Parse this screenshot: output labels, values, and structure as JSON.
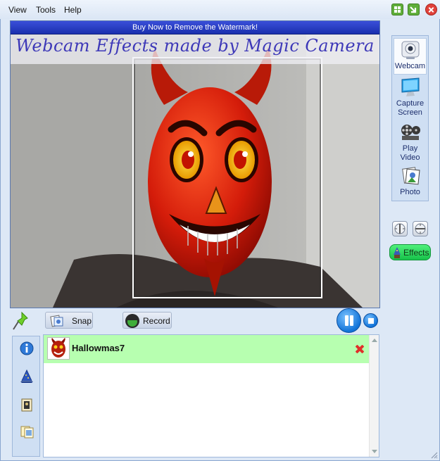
{
  "menu": {
    "items": [
      "View",
      "Tools",
      "Help"
    ]
  },
  "window_controls": {
    "layout_icon": "layout-grid-icon",
    "minimize_icon": "minimize-arrow-icon",
    "close_icon": "close-icon"
  },
  "video": {
    "banner": "Buy Now to Remove the Watermark!",
    "watermark": "Webcam Effects made by Magic Camera"
  },
  "sidebar": {
    "items": [
      {
        "label_lines": [
          "Webcam"
        ],
        "icon": "webcam-icon"
      },
      {
        "label_lines": [
          "Capture",
          "Screen"
        ],
        "icon": "monitor-icon"
      },
      {
        "label_lines": [
          "Play",
          "Video"
        ],
        "icon": "film-reel-icon"
      },
      {
        "label_lines": [
          "Photo"
        ],
        "icon": "photo-icon"
      }
    ],
    "effects_label": "Effects"
  },
  "controls": {
    "snap_label": "Snap",
    "record_label": "Record"
  },
  "effects_list": {
    "items": [
      {
        "name": "Hallowmas7",
        "icon": "devil-mask-icon"
      }
    ]
  },
  "colors": {
    "banner": "#2238c8",
    "effect_row": "#b7ffb0",
    "effects_button": "#2fd85c",
    "watermark_text": "#3d38b8"
  }
}
